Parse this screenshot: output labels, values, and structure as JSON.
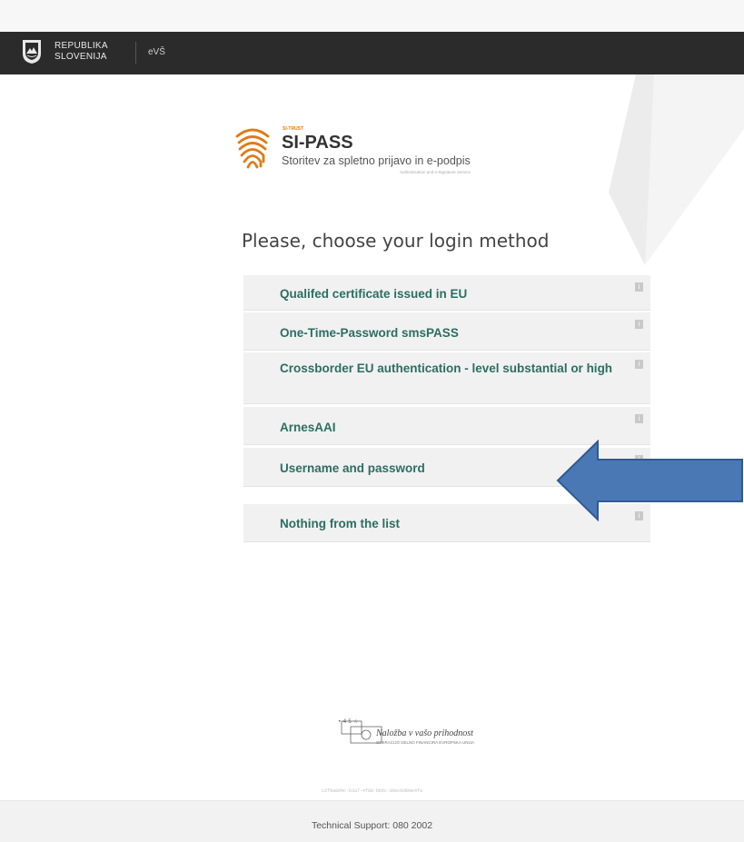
{
  "header": {
    "gov_name_line1": "REPUBLIKA",
    "gov_name_line2": "SLOVENIJA",
    "gov_sub": "eVŠ"
  },
  "brand": {
    "small_label": "SI-TRUST",
    "title": "SI-PASS",
    "subtitle": "Storitev za spletno prijavo in e-podpis",
    "tagline": "Authentication and e-Signature Service"
  },
  "main": {
    "heading": "Please, choose your login method",
    "options": [
      {
        "label": "Qualifed certificate issued in EU",
        "info": "i"
      },
      {
        "label": "One-Time-Password smsPASS",
        "info": "i"
      },
      {
        "label": "Crossborder EU authentication - level substantial or high",
        "info": "i"
      },
      {
        "label": "ArnesAAI",
        "info": "i"
      },
      {
        "label": "Username and password",
        "info": "i"
      },
      {
        "label": "Nothing from the list",
        "info": "i"
      }
    ]
  },
  "annotation": {
    "color": "#4a78b5",
    "icon": "left-arrow-icon"
  },
  "sponsor": {
    "text": "Naložba v vašo prihodnost",
    "subtext": "OPERACIJO DELNO FINANCIRA EVROPSKA UNIJA"
  },
  "footer": {
    "request_id": "c2f9a0d4c-b3a7-4f88-bb6c-89ecbd00e4fa",
    "support": "Technical Support: 080 2002"
  },
  "colors": {
    "accent_green": "#2c6e62",
    "brand_orange": "#e07b16",
    "govbar": "#2b2b2b"
  }
}
